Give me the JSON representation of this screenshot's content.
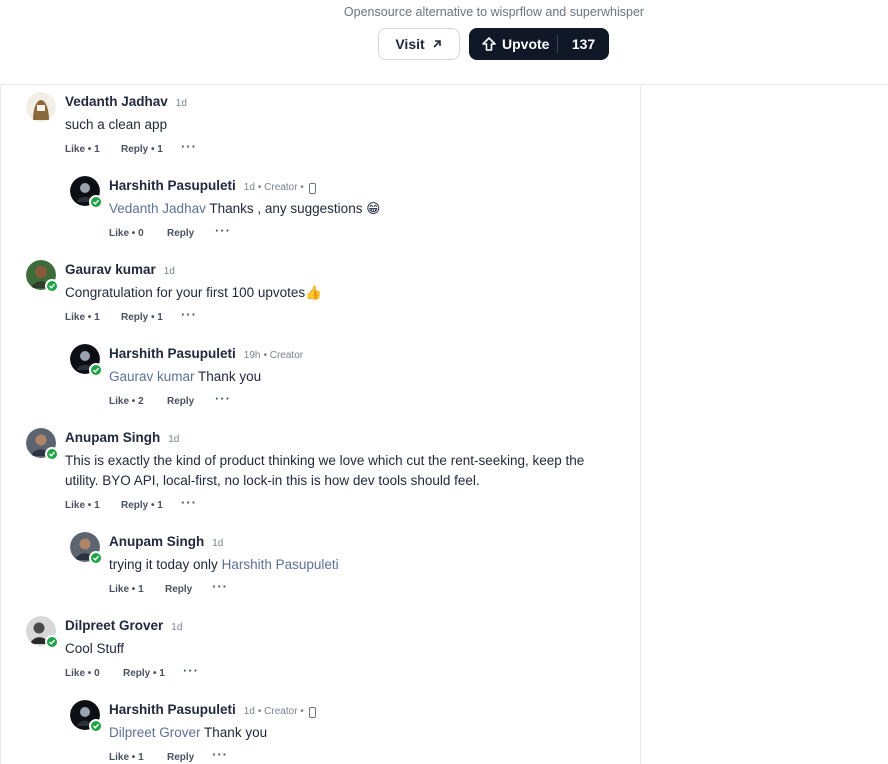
{
  "header": {
    "tagline": "Opensource alternative to wisprflow and superwhisper",
    "visit_label": "Visit",
    "upvote_label": "Upvote",
    "upvote_count": "137"
  },
  "comments": [
    {
      "name": "Vedanth Jadhav",
      "time": "1d",
      "text": "such a clean app",
      "like": "Like • 1",
      "reply": "Reply • 1",
      "more": "···"
    },
    {
      "name": "Harshith Pasupuleti",
      "time": "1d",
      "role": "• Creator •",
      "mention": "Vedanth Jadhav",
      "text": "Thanks , any suggestions 😁",
      "like": "Like • 0",
      "reply": "Reply",
      "more": "···"
    },
    {
      "name": "Gaurav kumar",
      "time": "1d",
      "text": "Congratulation for your first 100 upvotes👍",
      "like": "Like • 1",
      "reply": "Reply • 1",
      "more": "···"
    },
    {
      "name": "Harshith Pasupuleti",
      "time": "19h",
      "role": "• Creator",
      "mention": "Gaurav kumar",
      "text": "Thank you",
      "like": "Like • 2",
      "reply": "Reply",
      "more": "···"
    },
    {
      "name": "Anupam Singh",
      "time": "1d",
      "text": "This is exactly the kind of product thinking we love which cut the rent-seeking, keep the utility. BYO API, local-first, no lock-in this is how dev tools should feel.",
      "like": "Like • 1",
      "reply": "Reply • 1",
      "more": "···"
    },
    {
      "name": "Anupam Singh",
      "time": "1d",
      "text": "trying it today only",
      "mention": "Harshith Pasupuleti",
      "like": "Like • 1",
      "reply": "Reply",
      "more": "···"
    },
    {
      "name": "Dilpreet Grover",
      "time": "1d",
      "text": "Cool Stuff",
      "like": "Like • 0",
      "reply": "Reply • 1",
      "more": "···"
    },
    {
      "name": "Harshith Pasupuleti",
      "time": "1d",
      "role": "• Creator •",
      "mention": "Dilpreet Grover",
      "text": "Thank you",
      "like": "Like • 1",
      "reply": "Reply",
      "more": "···"
    }
  ],
  "colors": {
    "accent": "#101828",
    "verified": "#1ea446",
    "mention": "#5e7196"
  }
}
